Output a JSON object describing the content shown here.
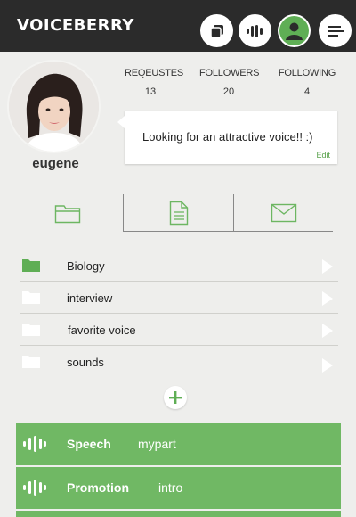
{
  "header": {
    "logo": "VOICEBERRY",
    "buttons": [
      "copy-icon",
      "voice-wave-icon",
      "profile-icon",
      "menu-icon"
    ]
  },
  "profile": {
    "username": "eugene",
    "stats": [
      {
        "label": "REQEUSTES",
        "value": "13"
      },
      {
        "label": "FOLLOWERS",
        "value": "20"
      },
      {
        "label": "FOLLOWING",
        "value": "4"
      }
    ],
    "status_message": "Looking for an attractive voice!! :)",
    "edit_label": "Edit"
  },
  "tabs": [
    "folder-icon",
    "document-icon",
    "mail-icon"
  ],
  "folders": [
    {
      "name": "Biology",
      "color": "#5fae55"
    },
    {
      "name": "interview",
      "color": "#ffffff"
    },
    {
      "name": "favorite voice",
      "color": "#ffffff"
    },
    {
      "name": "sounds",
      "color": "#ffffff"
    }
  ],
  "voices": [
    {
      "title": "Speech",
      "subtitle": "mypart"
    },
    {
      "title": "Promotion",
      "subtitle": "intro"
    }
  ],
  "colors": {
    "accent": "#70b864",
    "header_bg": "#2b2b2b",
    "page_bg": "#eeeeec"
  }
}
